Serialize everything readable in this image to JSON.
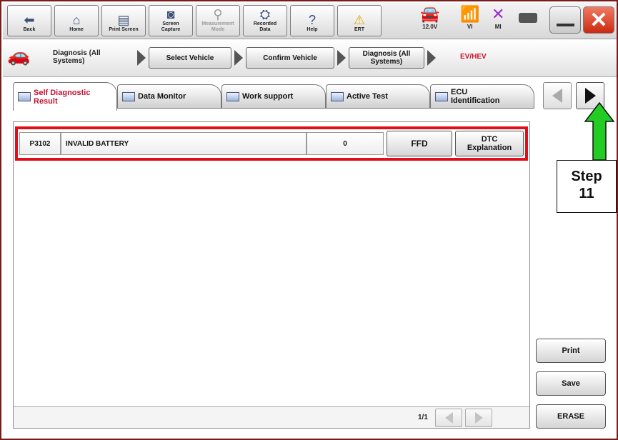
{
  "toolbar": {
    "buttons": [
      {
        "label": "Back",
        "icon": "back-arrow-icon"
      },
      {
        "label": "Home",
        "icon": "home-icon"
      },
      {
        "label": "Print Screen",
        "icon": "printer-icon"
      },
      {
        "label": "Screen\nCapture",
        "icon": "camera-icon"
      },
      {
        "label": "Measurement\nMode",
        "icon": "measurement-icon"
      },
      {
        "label": "Recorded\nData",
        "icon": "recorded-data-icon"
      },
      {
        "label": "Help",
        "icon": "help-icon"
      },
      {
        "label": "ERT",
        "icon": "warning-icon"
      }
    ],
    "status": {
      "voltage": "12.0V",
      "vi": "VI",
      "mi": "MI"
    }
  },
  "breadcrumb": {
    "first": "Diagnosis (All\nSystems)",
    "steps": [
      "Select Vehicle",
      "Confirm Vehicle",
      "Diagnosis (All\nSystems)"
    ],
    "current": "EV/HEV"
  },
  "tabs": [
    {
      "label": "Self Diagnostic\nResult",
      "active": true
    },
    {
      "label": "Data Monitor",
      "active": false
    },
    {
      "label": "Work support",
      "active": false
    },
    {
      "label": "Active Test",
      "active": false
    },
    {
      "label": "ECU\nIdentification",
      "active": false
    }
  ],
  "dtc_rows": [
    {
      "code": "P3102",
      "description": "INVALID BATTERY",
      "count": "0",
      "ffd_label": "FFD",
      "dtc_explanation_label": "DTC\nExplanation"
    }
  ],
  "pager": {
    "indicator": "1/1"
  },
  "actions": {
    "print": "Print",
    "save": "Save",
    "erase": "ERASE"
  },
  "annotation": {
    "line1": "Step",
    "line2": "11"
  },
  "colors": {
    "highlight": "#e0101a",
    "arrow": "#22cc22",
    "active_tab_text": "#c8102e",
    "close_button": "#cc2a10"
  }
}
